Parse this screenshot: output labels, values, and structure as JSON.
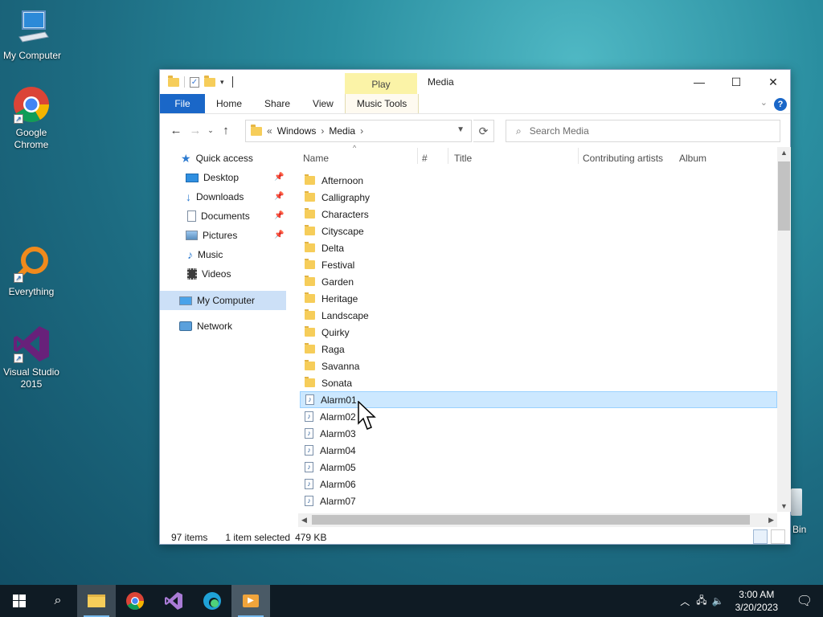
{
  "desktop": {
    "icons": [
      {
        "label": "My Computer"
      },
      {
        "label": "Google Chrome"
      },
      {
        "label": "Everything"
      },
      {
        "label": "Visual Studio 2015"
      }
    ],
    "recycle_bin_partial": "Bin"
  },
  "window": {
    "title": "Media",
    "contextual_tab": "Play",
    "ribbon_tabs": [
      "File",
      "Home",
      "Share",
      "View",
      "Music Tools"
    ],
    "controls": {
      "minimize": "—",
      "maximize": "☐",
      "close": "✕"
    },
    "help": "?"
  },
  "navbar": {
    "address": {
      "prefix": "«",
      "segments": [
        "Windows",
        "Media"
      ]
    },
    "search_placeholder": "Search Media"
  },
  "nav_pane": {
    "quick_access": "Quick access",
    "pinned": [
      {
        "label": "Desktop",
        "pinned": true
      },
      {
        "label": "Downloads",
        "pinned": true
      },
      {
        "label": "Documents",
        "pinned": true
      },
      {
        "label": "Pictures",
        "pinned": true
      },
      {
        "label": "Music",
        "pinned": false
      },
      {
        "label": "Videos",
        "pinned": false
      }
    ],
    "this_pc": "My Computer",
    "network": "Network"
  },
  "columns": [
    "Name",
    "#",
    "Title",
    "Contributing artists",
    "Album"
  ],
  "files": [
    {
      "name": "Afternoon",
      "type": "folder"
    },
    {
      "name": "Calligraphy",
      "type": "folder"
    },
    {
      "name": "Characters",
      "type": "folder"
    },
    {
      "name": "Cityscape",
      "type": "folder"
    },
    {
      "name": "Delta",
      "type": "folder"
    },
    {
      "name": "Festival",
      "type": "folder"
    },
    {
      "name": "Garden",
      "type": "folder"
    },
    {
      "name": "Heritage",
      "type": "folder"
    },
    {
      "name": "Landscape",
      "type": "folder"
    },
    {
      "name": "Quirky",
      "type": "folder"
    },
    {
      "name": "Raga",
      "type": "folder"
    },
    {
      "name": "Savanna",
      "type": "folder"
    },
    {
      "name": "Sonata",
      "type": "folder"
    },
    {
      "name": "Alarm01",
      "type": "audio",
      "selected": true
    },
    {
      "name": "Alarm02",
      "type": "audio"
    },
    {
      "name": "Alarm03",
      "type": "audio"
    },
    {
      "name": "Alarm04",
      "type": "audio"
    },
    {
      "name": "Alarm05",
      "type": "audio"
    },
    {
      "name": "Alarm06",
      "type": "audio"
    },
    {
      "name": "Alarm07",
      "type": "audio"
    }
  ],
  "status": {
    "item_count": "97 items",
    "selection": "1 item selected",
    "size": "479 KB"
  },
  "taskbar": {
    "time": "3:00 AM",
    "date": "3/20/2023"
  }
}
